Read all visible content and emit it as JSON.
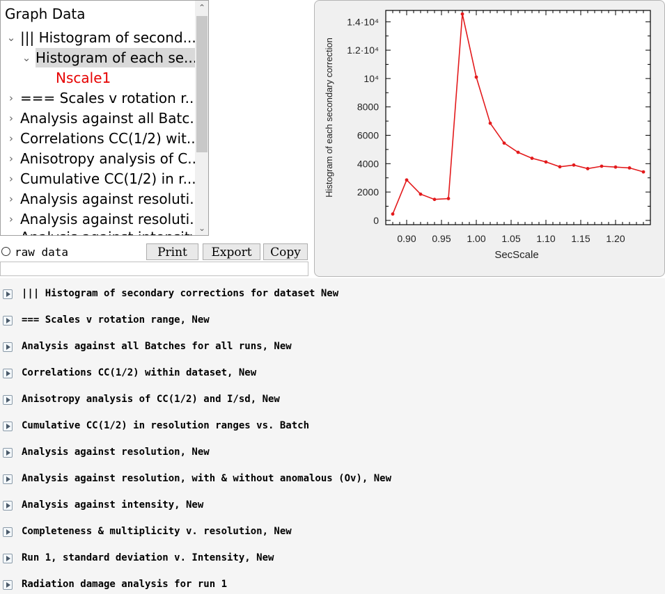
{
  "tree": {
    "title": "Graph Data",
    "nodes": [
      {
        "label": "||| Histogram of second...",
        "chevron": "expanded"
      },
      {
        "label": "Histogram of each se...",
        "chevron": "expanded"
      },
      {
        "label": "Nscale1",
        "chevron": ""
      },
      {
        "label": "=== Scales v rotation r...",
        "chevron": "collapsed"
      },
      {
        "label": "Analysis against all Batc...",
        "chevron": "collapsed"
      },
      {
        "label": "Correlations CC(1/2) wit...",
        "chevron": "collapsed"
      },
      {
        "label": "Anisotropy analysis of C...",
        "chevron": "collapsed"
      },
      {
        "label": "Cumulative CC(1/2) in r...",
        "chevron": "collapsed"
      },
      {
        "label": "Analysis against resoluti...",
        "chevron": "collapsed"
      },
      {
        "label": "Analysis against resoluti...",
        "chevron": "collapsed"
      },
      {
        "label": "Analysis against intensity...",
        "chevron": "collapsed"
      }
    ]
  },
  "controls": {
    "raw_data_label": "raw data",
    "print_label": "Print",
    "export_label": "Export",
    "copy_label": "Copy",
    "entry_value": ""
  },
  "chart_data": {
    "type": "line",
    "xlabel": "SecScale",
    "ylabel": "Histogram of each secondary correction",
    "xlim": [
      0.87,
      1.25
    ],
    "ylim": [
      -300,
      14800
    ],
    "x_ticks": [
      "0.90",
      "0.95",
      "1.00",
      "1.05",
      "1.10",
      "1.15",
      "1.20"
    ],
    "y_ticks": [
      "0",
      "2000",
      "4000",
      "6000",
      "8000",
      "10⁴",
      "1.2·10⁴",
      "1.4·10⁴"
    ],
    "series": [
      {
        "x": [
          0.88,
          0.9,
          0.92,
          0.94,
          0.96,
          0.98,
          1.0,
          1.02,
          1.04,
          1.06,
          1.08,
          1.1,
          1.12,
          1.14,
          1.16,
          1.18,
          1.2,
          1.22,
          1.24
        ],
        "values": [
          450,
          2850,
          1850,
          1480,
          1540,
          14550,
          10100,
          6850,
          5450,
          4800,
          4380,
          4120,
          3780,
          3900,
          3650,
          3820,
          3760,
          3700,
          3420
        ],
        "color": "#e31a1c"
      }
    ]
  },
  "log": {
    "items": [
      "||| Histogram of secondary corrections for dataset New",
      "=== Scales v rotation range, New",
      "Analysis against all Batches for all runs, New",
      "Correlations CC(1/2) within dataset, New",
      "Anisotropy analysis of CC(1/2) and I/sd, New",
      "Cumulative CC(1/2) in resolution ranges vs. Batch",
      "Analysis against resolution, New",
      "Analysis against resolution, with & without anomalous (Ov), New",
      "Analysis against intensity, New",
      "Completeness & multiplicity v. resolution, New",
      "Run 1, standard deviation v. Intensity, New",
      "Radiation damage analysis for run 1"
    ]
  }
}
